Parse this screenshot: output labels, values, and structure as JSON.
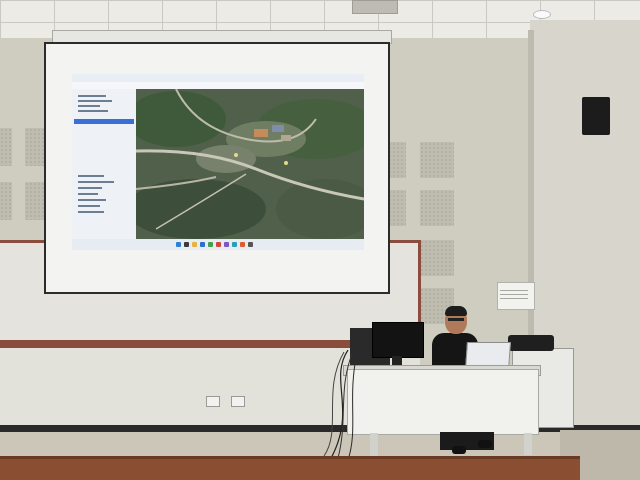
{
  "scene": {
    "type": "lecture hall photo",
    "projected_app": {
      "menu_text": "",
      "taskbar_icons": [
        "file-explorer-icon",
        "browser-icon",
        "folder-icon",
        "mail-icon",
        "settings-icon",
        "map-app-icon",
        "media-icon",
        "store-icon",
        "chrome-icon",
        "app-icon"
      ]
    },
    "colors": {
      "board_trim": "#8a4c3c",
      "bench": "#8a4f33",
      "screen_frame": "#2b2b2b",
      "selection_highlight": "#3a6fd8"
    }
  }
}
